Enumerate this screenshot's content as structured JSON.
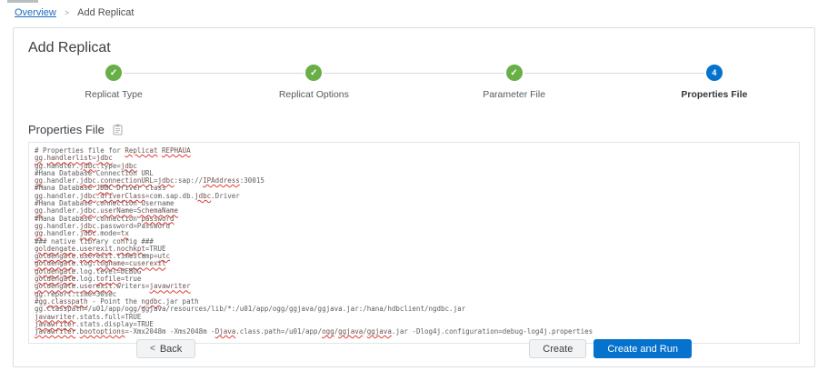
{
  "colors": {
    "accent_blue": "#0572ce",
    "success_green": "#68af46",
    "spell_red": "#de3b33",
    "link_blue": "#1a6cc0"
  },
  "breadcrumb": {
    "separator": ">",
    "items": [
      {
        "label": "Overview"
      },
      {
        "label": "Add Replicat"
      }
    ]
  },
  "page": {
    "title": "Add Replicat"
  },
  "stepper": {
    "steps": [
      {
        "label": "Replicat Type",
        "state": "done",
        "icon": "check"
      },
      {
        "label": "Replicat Options",
        "state": "done",
        "icon": "check"
      },
      {
        "label": "Parameter File",
        "state": "done",
        "icon": "check"
      },
      {
        "label": "Properties File",
        "state": "current",
        "number": "4"
      }
    ]
  },
  "properties_section": {
    "heading": "Properties File",
    "lines": [
      [
        {
          "t": "# Properties file for "
        },
        {
          "t": "Replicat",
          "u": true
        },
        {
          "t": " "
        },
        {
          "t": "REPHAUA",
          "u": true
        }
      ],
      [
        {
          "t": "gg",
          "u": true
        },
        {
          "t": "."
        },
        {
          "t": "handlerlist",
          "u": true
        },
        {
          "t": "="
        },
        {
          "t": "jdbc",
          "u": true
        }
      ],
      [
        {
          "t": "gg",
          "u": true
        },
        {
          "t": ".handler."
        },
        {
          "t": "jdbc",
          "u": true
        },
        {
          "t": ".type="
        },
        {
          "t": "jdbc",
          "u": true
        }
      ],
      [
        {
          "t": "#Hana Database Connection URL"
        }
      ],
      [
        {
          "t": "gg",
          "u": true
        },
        {
          "t": ".handler."
        },
        {
          "t": "jdbc",
          "u": true
        },
        {
          "t": "."
        },
        {
          "t": "connectionURL",
          "u": true
        },
        {
          "t": "="
        },
        {
          "t": "jdbc",
          "u": true
        },
        {
          "t": ":sap://"
        },
        {
          "t": "IPAddress",
          "u": true
        },
        {
          "t": ":30015"
        }
      ],
      [
        {
          "t": "#Hana Database "
        },
        {
          "t": "JDBC",
          "u": true
        },
        {
          "t": " Driver class"
        }
      ],
      [
        {
          "t": "gg",
          "u": true
        },
        {
          "t": ".handler."
        },
        {
          "t": "jdbc",
          "u": true
        },
        {
          "t": "."
        },
        {
          "t": "driverClass",
          "u": true
        },
        {
          "t": "=com.sap.db."
        },
        {
          "t": "jdbc",
          "u": true
        },
        {
          "t": ".Driver"
        }
      ],
      [
        {
          "t": "#Hana Database connection username"
        }
      ],
      [
        {
          "t": "gg",
          "u": true
        },
        {
          "t": ".handler."
        },
        {
          "t": "jdbc",
          "u": true
        },
        {
          "t": "."
        },
        {
          "t": "userName",
          "u": true
        },
        {
          "t": "="
        },
        {
          "t": "SchemaName",
          "u": true
        }
      ],
      [
        {
          "t": "#Hana Database connection "
        },
        {
          "t": "password",
          "u": true
        }
      ],
      [
        {
          "t": "gg",
          "u": true
        },
        {
          "t": ".handler."
        },
        {
          "t": "jdbc",
          "u": true
        },
        {
          "t": ".password=Password"
        }
      ],
      [
        {
          "t": "gg",
          "u": true
        },
        {
          "t": ".handler."
        },
        {
          "t": "jdbc",
          "u": true
        },
        {
          "t": ".mode="
        },
        {
          "t": "tx",
          "u": true
        }
      ],
      [
        {
          "t": "### native library config ###"
        }
      ],
      [
        {
          "t": "goldengate",
          "u": true
        },
        {
          "t": "."
        },
        {
          "t": "userexit",
          "u": true
        },
        {
          "t": "."
        },
        {
          "t": "nochkpt",
          "u": true
        },
        {
          "t": "=TRUE"
        }
      ],
      [
        {
          "t": "goldengate",
          "u": true
        },
        {
          "t": "."
        },
        {
          "t": "userexit",
          "u": true
        },
        {
          "t": ".timestamp="
        },
        {
          "t": "utc",
          "u": true
        }
      ],
      [
        {
          "t": "goldengate",
          "u": true
        },
        {
          "t": ".log."
        },
        {
          "t": "logname",
          "u": true
        },
        {
          "t": "="
        },
        {
          "t": "cuserexit",
          "u": true
        }
      ],
      [
        {
          "t": "goldengate",
          "u": true
        },
        {
          "t": ".log.level=DEBUG"
        }
      ],
      [
        {
          "t": "goldengate",
          "u": true
        },
        {
          "t": ".log."
        },
        {
          "t": "tofile",
          "u": true
        },
        {
          "t": "=true"
        }
      ],
      [
        {
          "t": "goldengate",
          "u": true
        },
        {
          "t": "."
        },
        {
          "t": "userexit",
          "u": true
        },
        {
          "t": ".writers="
        },
        {
          "t": "javawriter",
          "u": true
        }
      ],
      [
        {
          "t": "gg",
          "u": true
        },
        {
          "t": ".report.time=30sec"
        }
      ],
      [
        {
          "t": "#"
        },
        {
          "t": "gg.classpath",
          "u": true
        },
        {
          "t": " - Point the "
        },
        {
          "t": "ngdbc",
          "u": true
        },
        {
          "t": ".jar path"
        }
      ],
      [
        {
          "t": "gg.classpath=/u01/app/ogg/ggjava/resources/lib/*:/u01/app/ogg/ggjava/ggjava.jar:/hana/hdbclient/ngdbc.jar"
        }
      ],
      [
        {
          "t": "javawriter",
          "u": true
        },
        {
          "t": ".stats.full=TRUE"
        }
      ],
      [
        {
          "t": "javawriter",
          "u": true
        },
        {
          "t": ".stats.display=TRUE"
        }
      ],
      [
        {
          "t": "javawriter",
          "u": true
        },
        {
          "t": "."
        },
        {
          "t": "bootoptions",
          "u": true
        },
        {
          "t": "=-Xmx2048m -Xms2048m -"
        },
        {
          "t": "Djava",
          "u": true
        },
        {
          "t": ".class.path=/u01/app/"
        },
        {
          "t": "ogg",
          "u": true
        },
        {
          "t": "/"
        },
        {
          "t": "ggjava",
          "u": true
        },
        {
          "t": "/"
        },
        {
          "t": "ggjava",
          "u": true
        },
        {
          "t": ".jar -Dlog4j.configuration=debug-log4j.properties"
        }
      ]
    ]
  },
  "footer": {
    "back_chevron": "<",
    "back_label": "Back",
    "create_label": "Create",
    "create_run_label": "Create and Run"
  }
}
